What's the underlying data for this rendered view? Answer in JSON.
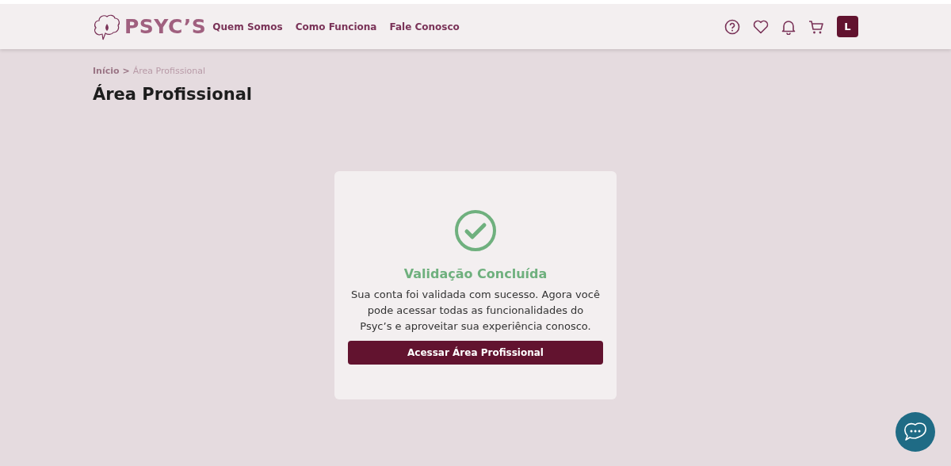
{
  "brand": {
    "name": "PSYC’S"
  },
  "nav": [
    {
      "label": "Quem Somos"
    },
    {
      "label": "Como Funciona"
    },
    {
      "label": "Fale Conosco"
    }
  ],
  "user": {
    "initial": "L"
  },
  "breadcrumb": [
    {
      "label": "Início",
      "current": false
    },
    {
      "label": ">",
      "current": false
    },
    {
      "label": "Área Profissional",
      "current": true
    }
  ],
  "page_title": "Área Profissional",
  "dialog": {
    "title": "Validação Concluída",
    "message": "Sua conta foi validada com sucesso. Agora você pode acessar todas as funcionalidades do Psyc’s e aproveitar sua experiência conosco.",
    "button": "Acessar Área Profissional"
  }
}
